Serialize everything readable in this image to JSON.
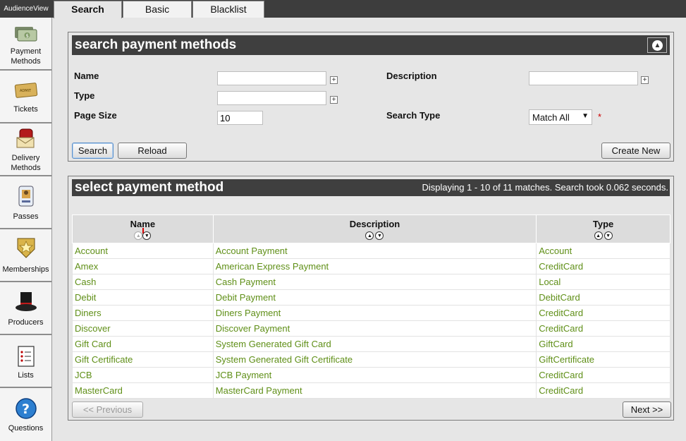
{
  "app": {
    "brand": "AudienceView"
  },
  "tabs": [
    {
      "label": "Search",
      "active": true
    },
    {
      "label": "Basic",
      "active": false
    },
    {
      "label": "Blacklist",
      "active": false
    }
  ],
  "sidebar": {
    "items": [
      {
        "label": "Payment Methods",
        "icon": "money-icon"
      },
      {
        "label": "Tickets",
        "icon": "ticket-icon"
      },
      {
        "label": "Delivery Methods",
        "icon": "mailbox-icon"
      },
      {
        "label": "Passes",
        "icon": "pass-card-icon"
      },
      {
        "label": "Memberships",
        "icon": "star-badge-icon"
      },
      {
        "label": "Producers",
        "icon": "top-hat-icon"
      },
      {
        "label": "Lists",
        "icon": "list-icon"
      },
      {
        "label": "Questions",
        "icon": "help-icon"
      }
    ]
  },
  "search": {
    "title": "search payment methods",
    "name_label": "Name",
    "name_value": "",
    "type_label": "Type",
    "type_value": "",
    "page_size_label": "Page Size",
    "page_size_value": "10",
    "description_label": "Description",
    "description_value": "",
    "search_type_label": "Search Type",
    "search_type_value": "Match All",
    "required_mark": "*",
    "search_button": "Search",
    "reload_button": "Reload",
    "create_button": "Create New"
  },
  "results": {
    "title": "select payment method",
    "match_info": "Displaying 1 - 10 of 11 matches. Search took 0.062 seconds.",
    "columns": [
      "Name",
      "Description",
      "Type"
    ],
    "rows": [
      [
        "Account",
        "Account Payment",
        "Account"
      ],
      [
        "Amex",
        "American Express Payment",
        "CreditCard"
      ],
      [
        "Cash",
        "Cash Payment",
        "Local"
      ],
      [
        "Debit",
        "Debit Payment",
        "DebitCard"
      ],
      [
        "Diners",
        "Diners Payment",
        "CreditCard"
      ],
      [
        "Discover",
        "Discover Payment",
        "CreditCard"
      ],
      [
        "Gift Card",
        "System Generated Gift Card",
        "GiftCard"
      ],
      [
        "Gift Certificate",
        "System Generated Gift Certificate",
        "GiftCertificate"
      ],
      [
        "JCB",
        "JCB Payment",
        "CreditCard"
      ],
      [
        "MasterCard",
        "MasterCard Payment",
        "CreditCard"
      ]
    ],
    "prev_button": "<< Previous",
    "next_button": "Next >>"
  },
  "colors": {
    "link": "#5f8f17",
    "header": "#3f3f3f",
    "required": "#cc0000"
  }
}
